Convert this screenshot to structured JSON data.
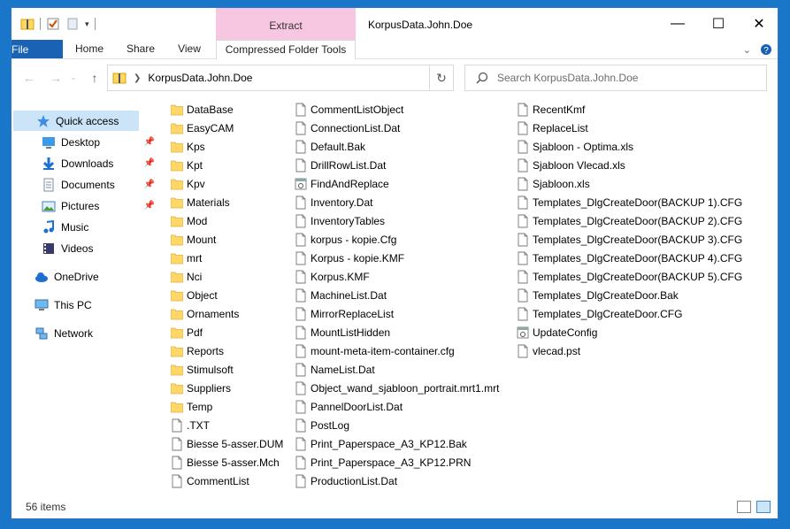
{
  "window": {
    "title": "KorpusData.John.Doe",
    "contextual_tab": "Extract",
    "controls": {
      "minimize": "—",
      "maximize": "☐",
      "close": "✕"
    }
  },
  "ribbon": {
    "tabs": [
      {
        "label": "File"
      },
      {
        "label": "Home"
      },
      {
        "label": "Share"
      },
      {
        "label": "View"
      },
      {
        "label": "Compressed Folder Tools"
      }
    ]
  },
  "address": {
    "path": "KorpusData.John.Doe"
  },
  "search": {
    "placeholder": "Search KorpusData.John.Doe"
  },
  "nav": {
    "quick_access": "Quick access",
    "items": [
      {
        "label": "Desktop",
        "icon": "desktop-icon"
      },
      {
        "label": "Downloads",
        "icon": "download-icon"
      },
      {
        "label": "Documents",
        "icon": "document-icon"
      },
      {
        "label": "Pictures",
        "icon": "pictures-icon"
      },
      {
        "label": "Music",
        "icon": "music-icon"
      },
      {
        "label": "Videos",
        "icon": "video-icon"
      }
    ],
    "onedrive": "OneDrive",
    "this_pc": "This PC",
    "network": "Network"
  },
  "files": {
    "col1": [
      {
        "name": "DataBase",
        "type": "folder"
      },
      {
        "name": "EasyCAM",
        "type": "folder"
      },
      {
        "name": "Kps",
        "type": "folder"
      },
      {
        "name": "Kpt",
        "type": "folder"
      },
      {
        "name": "Kpv",
        "type": "folder"
      },
      {
        "name": "Materials",
        "type": "folder"
      },
      {
        "name": "Mod",
        "type": "folder"
      },
      {
        "name": "Mount",
        "type": "folder"
      },
      {
        "name": "mrt",
        "type": "folder"
      },
      {
        "name": "Nci",
        "type": "folder"
      },
      {
        "name": "Object",
        "type": "folder"
      },
      {
        "name": "Ornaments",
        "type": "folder"
      },
      {
        "name": "Pdf",
        "type": "folder"
      },
      {
        "name": "Reports",
        "type": "folder"
      },
      {
        "name": "Stimulsoft",
        "type": "folder"
      },
      {
        "name": "Suppliers",
        "type": "folder"
      },
      {
        "name": "Temp",
        "type": "folder"
      },
      {
        "name": ".TXT",
        "type": "file"
      },
      {
        "name": "Biesse 5-asser.DUM",
        "type": "file"
      },
      {
        "name": "Biesse 5-asser.Mch",
        "type": "file"
      },
      {
        "name": "CommentList",
        "type": "file"
      }
    ],
    "col2": [
      {
        "name": "CommentListObject",
        "type": "file"
      },
      {
        "name": "ConnectionList.Dat",
        "type": "file"
      },
      {
        "name": "Default.Bak",
        "type": "file"
      },
      {
        "name": "DrillRowList.Dat",
        "type": "file"
      },
      {
        "name": "FindAndReplace",
        "type": "app"
      },
      {
        "name": "Inventory.Dat",
        "type": "file"
      },
      {
        "name": "InventoryTables",
        "type": "file"
      },
      {
        "name": "korpus - kopie.Cfg",
        "type": "file"
      },
      {
        "name": "Korpus - kopie.KMF",
        "type": "file"
      },
      {
        "name": "Korpus.KMF",
        "type": "file"
      },
      {
        "name": "MachineList.Dat",
        "type": "file"
      },
      {
        "name": "MirrorReplaceList",
        "type": "file"
      },
      {
        "name": "MountListHidden",
        "type": "file"
      },
      {
        "name": "mount-meta-item-container.cfg",
        "type": "file"
      },
      {
        "name": "NameList.Dat",
        "type": "file"
      },
      {
        "name": "Object_wand_sjabloon_portrait.mrt1.mrt",
        "type": "file"
      },
      {
        "name": "PannelDoorList.Dat",
        "type": "file"
      },
      {
        "name": "PostLog",
        "type": "file"
      },
      {
        "name": "Print_Paperspace_A3_KP12.Bak",
        "type": "file"
      },
      {
        "name": "Print_Paperspace_A3_KP12.PRN",
        "type": "file"
      },
      {
        "name": "ProductionList.Dat",
        "type": "file"
      }
    ],
    "col3": [
      {
        "name": "RecentKmf",
        "type": "file"
      },
      {
        "name": "ReplaceList",
        "type": "file"
      },
      {
        "name": "Sjabloon - Optima.xls",
        "type": "file"
      },
      {
        "name": "Sjabloon Vlecad.xls",
        "type": "file"
      },
      {
        "name": "Sjabloon.xls",
        "type": "file"
      },
      {
        "name": "Templates_DlgCreateDoor(BACKUP 1).CFG",
        "type": "file"
      },
      {
        "name": "Templates_DlgCreateDoor(BACKUP 2).CFG",
        "type": "file"
      },
      {
        "name": "Templates_DlgCreateDoor(BACKUP 3).CFG",
        "type": "file"
      },
      {
        "name": "Templates_DlgCreateDoor(BACKUP 4).CFG",
        "type": "file"
      },
      {
        "name": "Templates_DlgCreateDoor(BACKUP 5).CFG",
        "type": "file"
      },
      {
        "name": "Templates_DlgCreateDoor.Bak",
        "type": "file"
      },
      {
        "name": "Templates_DlgCreateDoor.CFG",
        "type": "file"
      },
      {
        "name": "UpdateConfig",
        "type": "app"
      },
      {
        "name": "vlecad.pst",
        "type": "file"
      }
    ]
  },
  "status": {
    "count": "56 items"
  },
  "colors": {
    "file_tab": "#1a62b3",
    "context_tab": "#f7c6e0",
    "selection": "#cce4f7",
    "folder": "#ffd766"
  }
}
